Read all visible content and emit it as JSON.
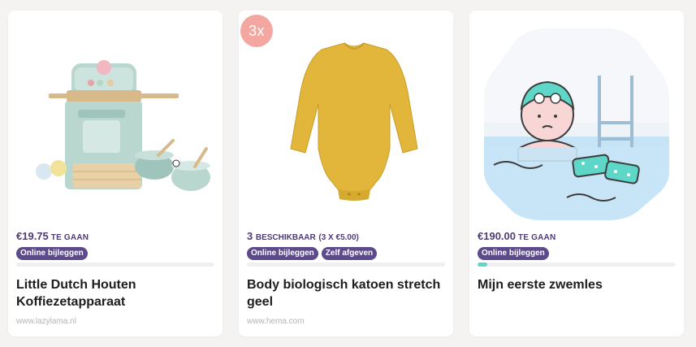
{
  "cards": [
    {
      "image_name": "koffiezetapparaat-image",
      "price": "€19.75",
      "price_suffix": "TE GAAN",
      "badges": [
        "Online bijleggen"
      ],
      "progress": 0.0,
      "title": "Little Dutch Houten Koffiezetapparaat",
      "source": "www.lazylama.nl"
    },
    {
      "image_name": "romper-image",
      "quantity_badge": "3x",
      "available": "3",
      "available_label": "BESCHIKBAAR",
      "available_detail": "(3 X €5.00)",
      "badges": [
        "Online bijleggen",
        "Zelf afgeven"
      ],
      "progress": 0.0,
      "title": "Body biologisch katoen stretch geel",
      "source": "www.hema.com"
    },
    {
      "image_name": "zwemles-illustration",
      "price": "€190.00",
      "price_suffix": "TE GAAN",
      "badges": [
        "Online bijleggen"
      ],
      "progress": 0.05,
      "title": "Mijn eerste zwemles",
      "source": ""
    }
  ],
  "colors": {
    "accent": "#5d4a8a",
    "price": "#4f3b77",
    "progress": "#5ed7c8",
    "qty_badge": "#f4a7a1"
  }
}
